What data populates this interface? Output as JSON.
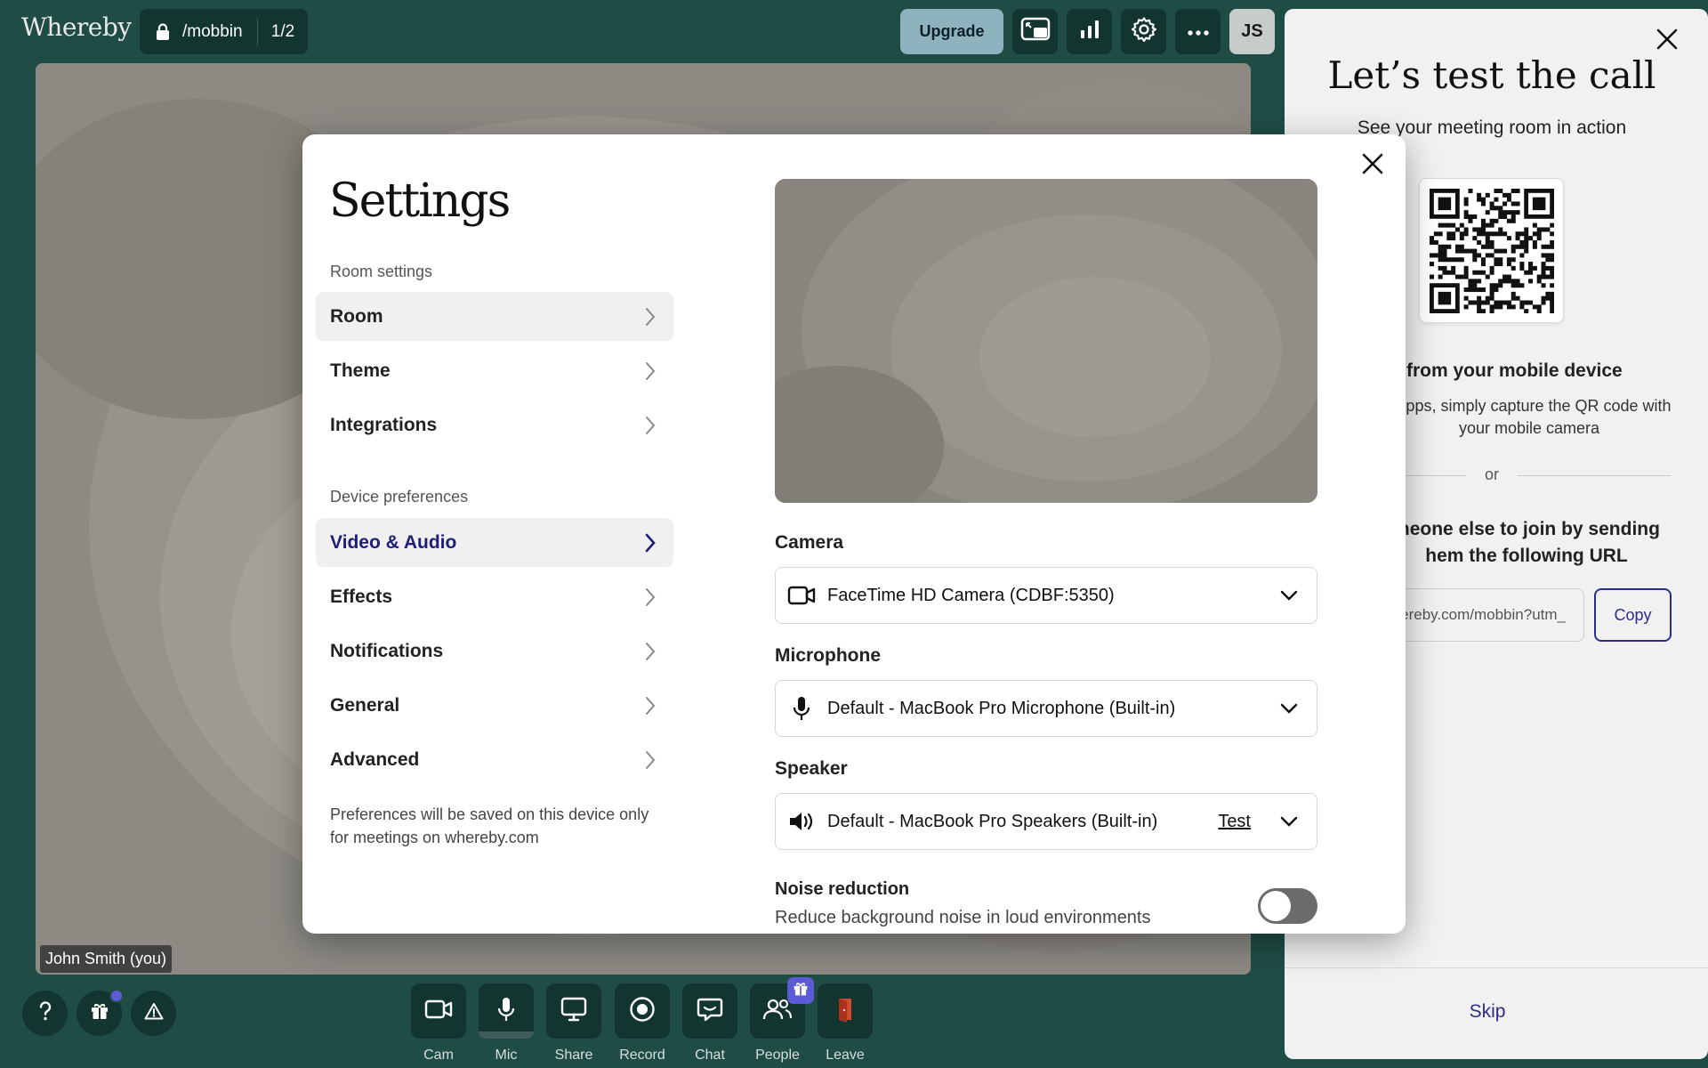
{
  "app": {
    "logo": "Whereby"
  },
  "topbar": {
    "room_name": "/mobbin",
    "room_count": "1/2",
    "upgrade_label": "Upgrade",
    "avatar_initials": "JS"
  },
  "video": {
    "participant_name": "John Smith (you)"
  },
  "toolbar": {
    "items": [
      {
        "label": "Cam"
      },
      {
        "label": "Mic"
      },
      {
        "label": "Share"
      },
      {
        "label": "Record"
      },
      {
        "label": "Chat"
      },
      {
        "label": "People"
      },
      {
        "label": "Leave"
      }
    ]
  },
  "right_panel": {
    "title": "Let’s test the call",
    "subtitle": "See your meeting room in action",
    "mobile_heading": "from your mobile device",
    "mobile_text": "r apps, simply capture the QR code with your mobile camera",
    "or_label": "or",
    "invite_heading": "meone else to join by sending hem the following URL",
    "url_value": "ereby.com/mobbin?utm_",
    "copy_label": "Copy",
    "skip_label": "Skip"
  },
  "settings": {
    "title": "Settings",
    "room_section_label": "Room settings",
    "room_items": [
      {
        "label": "Room"
      },
      {
        "label": "Theme"
      },
      {
        "label": "Integrations"
      }
    ],
    "device_section_label": "Device preferences",
    "device_items": [
      {
        "label": "Video & Audio"
      },
      {
        "label": "Effects"
      },
      {
        "label": "Notifications"
      },
      {
        "label": "General"
      },
      {
        "label": "Advanced"
      }
    ],
    "note": "Preferences will be saved on this device only for meetings on whereby.com",
    "camera_label": "Camera",
    "camera_value": "FaceTime HD Camera (CDBF:5350)",
    "microphone_label": "Microphone",
    "microphone_value": "Default - MacBook Pro Microphone (Built-in)",
    "speaker_label": "Speaker",
    "speaker_value": "Default - MacBook Pro Speakers (Built-in)",
    "speaker_test_label": "Test",
    "noise_title": "Noise reduction",
    "noise_desc": "Reduce background noise in loud environments",
    "noise_enabled": false
  },
  "colors": {
    "background": "#1f4d45",
    "dark_button": "#123530",
    "accent": "#2c2c8c",
    "upgrade": "#8fb2bf",
    "leave_icon": "#d04a2f"
  }
}
